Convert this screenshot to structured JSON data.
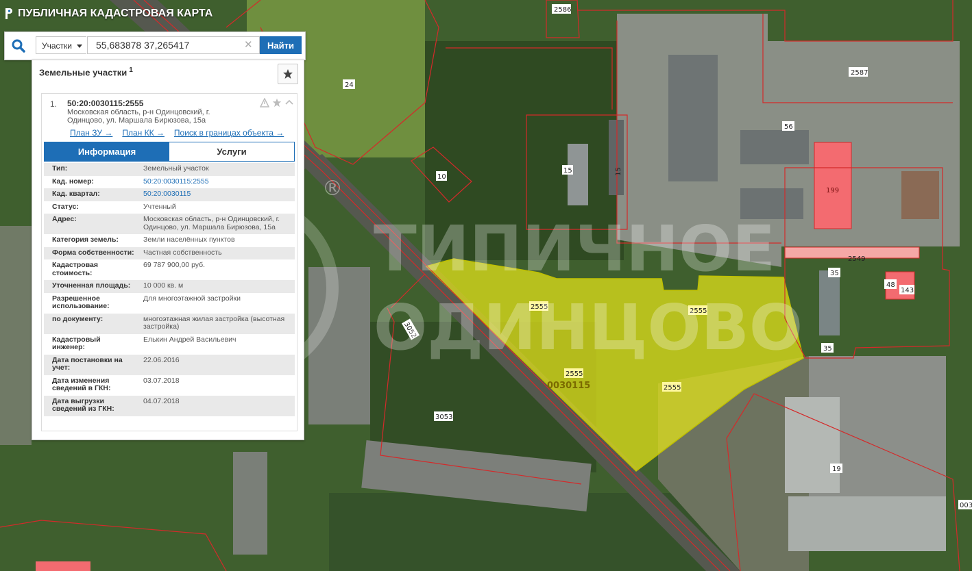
{
  "header": {
    "title": "ПУБЛИЧНАЯ КАДАСТРОВАЯ КАРТА"
  },
  "search": {
    "type_label": "Участки",
    "query": "55,683878 37,265417",
    "find_label": "Найти"
  },
  "panel": {
    "title": "Земельные участки",
    "count": "1"
  },
  "result": {
    "number": "1.",
    "cadastral_id": "50:20:0030115:2555",
    "address": "Московская область, р-н Одинцовский, г. Одинцово, ул. Маршала Бирюзова, 15а",
    "links": {
      "plan_zu": "План ЗУ →",
      "plan_kk": "План КК →",
      "search_bounds": "Поиск в границах объекта →"
    },
    "tabs": {
      "info": "Информация",
      "services": "Услуги"
    },
    "fields": [
      {
        "label": "Тип:",
        "value": "Земельный участок"
      },
      {
        "label": "Кад. номер:",
        "value": "50:20:0030115:2555"
      },
      {
        "label": "Кад. квартал:",
        "value": "50:20:0030115"
      },
      {
        "label": "Статус:",
        "value": "Учтенный"
      },
      {
        "label": "Адрес:",
        "value": "Московская область, р-н Одинцовский, г. Одинцово, ул. Маршала Бирюзова, 15а"
      },
      {
        "label": "Категория земель:",
        "value": "Земли населённых пунктов"
      },
      {
        "label": "Форма собственности:",
        "value": "Частная собственность"
      },
      {
        "label": "Кадастровая стоимость:",
        "value": "69 787 900,00 руб."
      },
      {
        "label": "Уточненная площадь:",
        "value": "10 000 кв. м"
      },
      {
        "label": "Разрешенное использование:",
        "value": "Для многоэтажной застройки"
      },
      {
        "label": "по документу:",
        "value": "многоэтажная жилая застройка (высотная застройка)"
      },
      {
        "label": "Кадастровый инженер:",
        "value": "Елькин Андрей Васильевич"
      },
      {
        "label": "Дата постановки на учет:",
        "value": "22.06.2016"
      },
      {
        "label": "Дата изменения сведений в ГКН:",
        "value": "03.07.2018"
      },
      {
        "label": "Дата выгрузки сведений из ГКН:",
        "value": "04.07.2018"
      }
    ]
  },
  "map": {
    "labels": {
      "p2586": "2586",
      "p2587": "2587",
      "p24": "24",
      "p10": "10",
      "p15a": "15",
      "p15b": "15",
      "p56": "56",
      "p199": "199",
      "p2549": "2549",
      "p35a": "35",
      "p35b": "35",
      "p48": "48",
      "p143": "143",
      "p2555a": "2555",
      "p2555b": "2555",
      "p2555c": "2555",
      "p2555d": "2555",
      "quarter": "0030115",
      "p3052": "3052",
      "p3053": "3053",
      "p19": "19",
      "p003": "003"
    },
    "watermark": {
      "line1": "ТИПИЧНОЕ",
      "line2": "ОДИНЦОВО",
      "reg": "®"
    },
    "colors": {
      "selected_fill": "#e6e619",
      "boundary": "#d42a2a",
      "building_highlight": "#f36b70"
    }
  }
}
